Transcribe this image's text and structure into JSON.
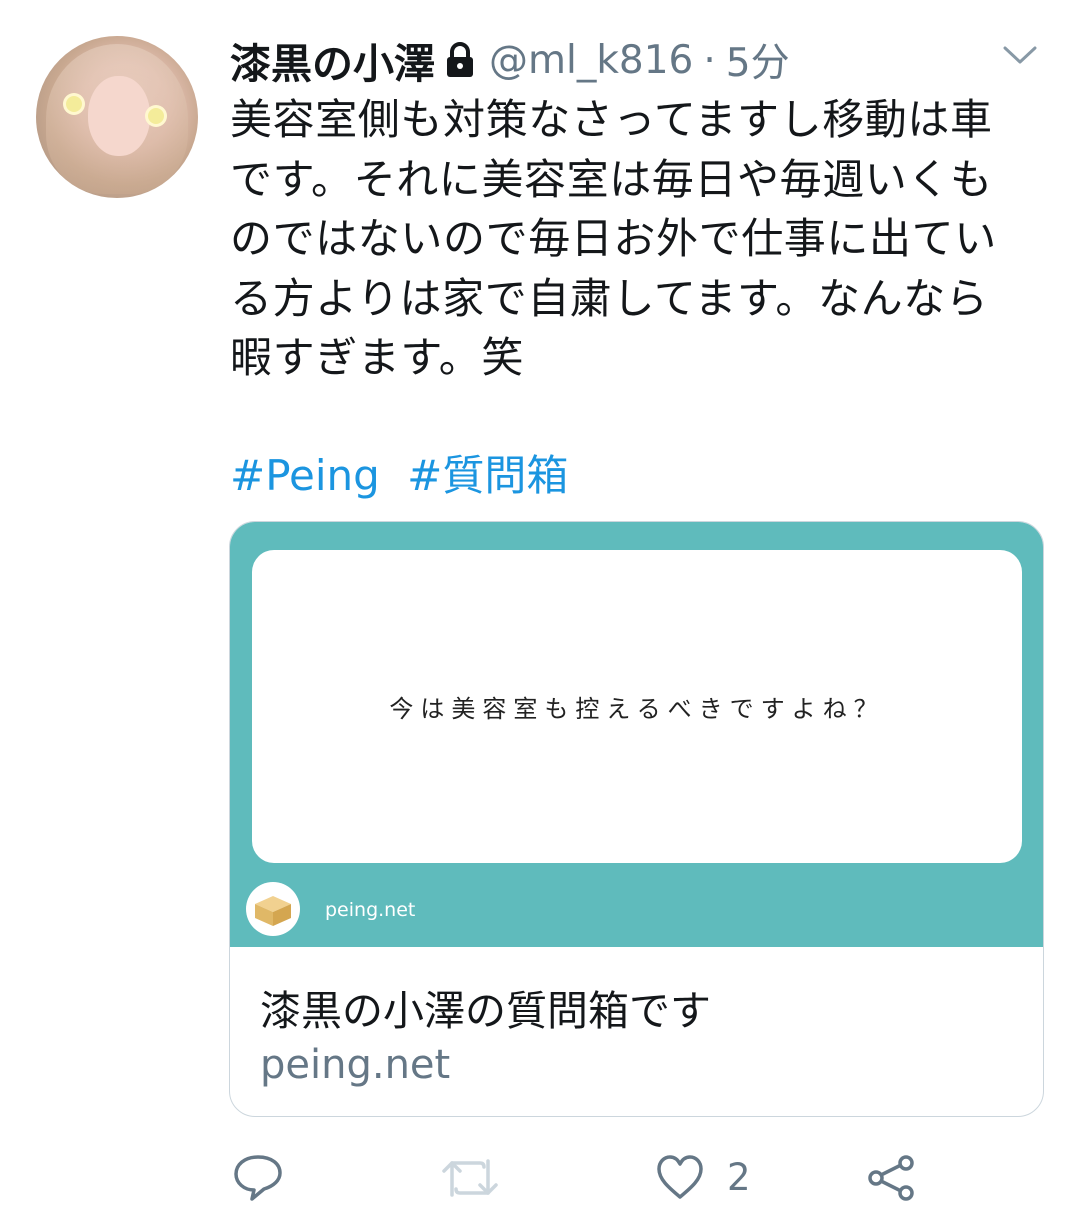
{
  "tweet": {
    "author_name": "漆黒の小澤",
    "handle": "@ml_k816",
    "separator": "·",
    "time": "5分",
    "lines": [
      "美容室側も対策なさってますし移動は車",
      "です。それに美容室は毎日や毎週いくも",
      "のではないので毎日お外で仕事に出てい",
      "る方よりは家で自粛してます。なんなら",
      "暇すぎます。笑"
    ],
    "hashtags": [
      "#Peing",
      "#質問箱"
    ]
  },
  "card": {
    "question": "今は美容室も控えるべきですよね？",
    "site_label": "peing.net",
    "title": "漆黒の小澤の質問箱です",
    "domain": "peing.net",
    "image_bg": "#5fbbbc"
  },
  "actions": {
    "like_count": "2"
  },
  "icons": [
    "lock-icon",
    "chevron-down-icon",
    "reply-icon",
    "retweet-icon",
    "like-icon",
    "share-icon",
    "box-icon"
  ],
  "colors": {
    "link": "#1b95e0",
    "secondary": "#657786",
    "text": "#14171a"
  }
}
